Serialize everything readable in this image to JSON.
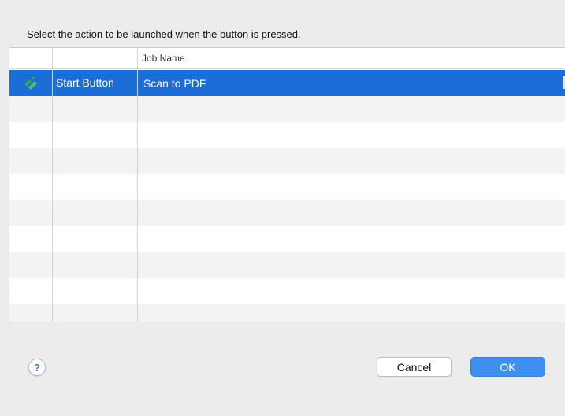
{
  "instruction": "Select the action to be launched when the button is pressed.",
  "table": {
    "columns": [
      "",
      "",
      "Job Name"
    ],
    "rows": [
      {
        "icon": "epson-scan-icon",
        "button": "Start Button",
        "job": "Scan to PDF",
        "selected": true
      }
    ],
    "empty_row_count": 9
  },
  "buttons": {
    "help": "?",
    "cancel": "Cancel",
    "ok": "OK"
  },
  "colors": {
    "selection": "#1d6dd6",
    "ok_button": "#3f8ff0",
    "icon_green": "#2fa84f"
  }
}
